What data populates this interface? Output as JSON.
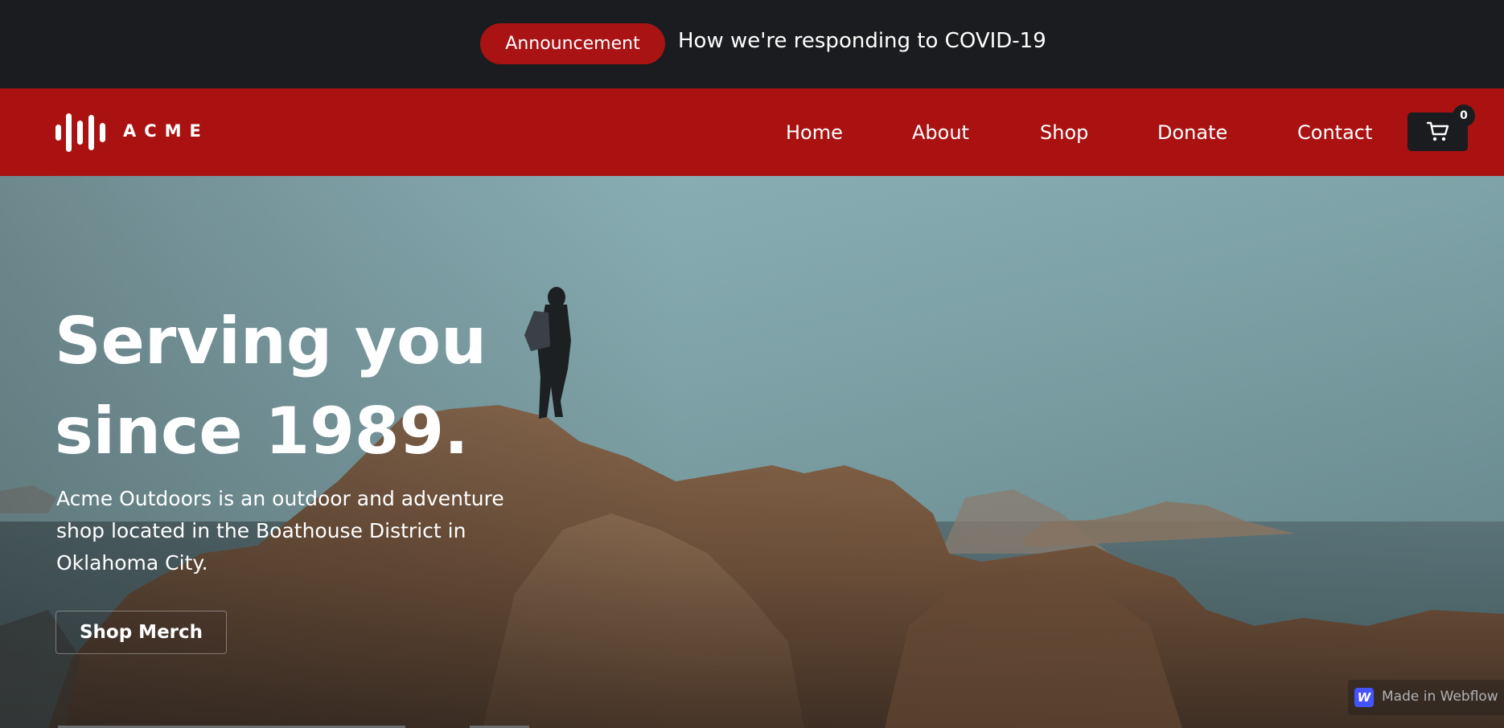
{
  "announcement_bar": {
    "badge": "Announcement",
    "text": "How we're responding to COVID-19"
  },
  "navbar": {
    "logo_text": "ACME",
    "items": [
      {
        "label": "Home"
      },
      {
        "label": "About"
      },
      {
        "label": "Shop"
      },
      {
        "label": "Donate"
      },
      {
        "label": "Contact"
      }
    ],
    "cart_count": "0",
    "colors": {
      "nav_bg": "#aa1212",
      "top_bg": "#1b1c1f",
      "accent": "#a91313"
    }
  },
  "hero": {
    "title": "Serving you\nsince 1989.",
    "description": "Acme Outdoors is an outdoor and adventure shop located in the Boathouse District in Oklahoma City.",
    "cta_label": "Shop Merch"
  },
  "badge": {
    "text": "Made in Webflow",
    "icon_letter": "W"
  },
  "icons": {
    "logo": "soundwave-logo-icon",
    "cart": "cart-icon",
    "webflow": "webflow-logo-icon"
  }
}
